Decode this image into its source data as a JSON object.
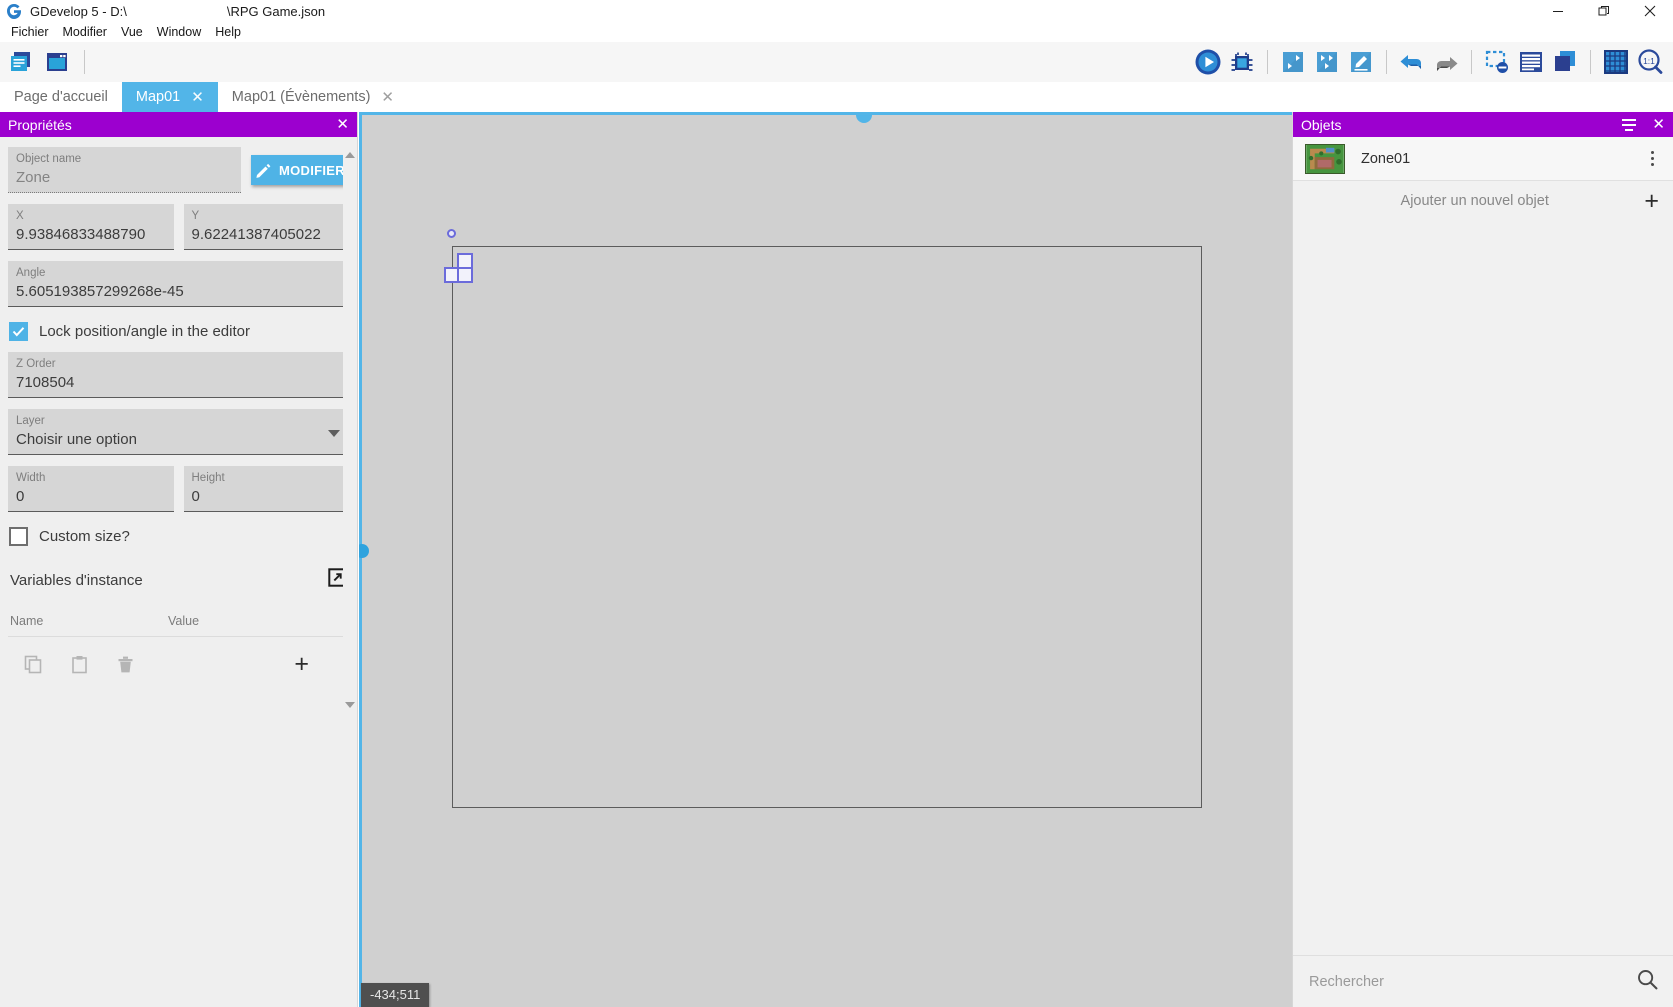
{
  "window": {
    "app_title": "GDevelop 5 - D:\\",
    "file_path": "\\RPG Game.json",
    "controls": {
      "minimize": "—",
      "restore": "❐",
      "close": "✕"
    }
  },
  "menubar": {
    "items": [
      {
        "label": "Fichier",
        "name": "menu-fichier"
      },
      {
        "label": "Modifier",
        "name": "menu-modifier"
      },
      {
        "label": "Vue",
        "name": "menu-vue"
      },
      {
        "label": "Window",
        "name": "menu-window"
      },
      {
        "label": "Help",
        "name": "menu-help"
      }
    ]
  },
  "toolbar": {
    "left_icons": [
      {
        "name": "project-manager-icon",
        "title": "Gestionnaire de projet"
      },
      {
        "name": "open-window-icon",
        "title": "Fenetre"
      }
    ],
    "right_icons": [
      {
        "name": "play-preview-icon",
        "title": "Aperçu"
      },
      {
        "name": "debug-icon",
        "title": "Débogage"
      },
      {
        "name": "add-scene-icon",
        "title": "Ajouter une scène"
      },
      {
        "name": "external-layout-icon",
        "title": "Disposition externe"
      },
      {
        "name": "edit-scene-icon",
        "title": "Éditer"
      },
      {
        "name": "undo-icon",
        "title": "Annuler"
      },
      {
        "name": "redo-icon",
        "title": "Rétablir"
      },
      {
        "name": "no-selection-icon",
        "title": "Désélectionner"
      },
      {
        "name": "open-list-icon",
        "title": "Liste"
      },
      {
        "name": "layers-icon",
        "title": "Calques"
      },
      {
        "name": "grid-icon",
        "title": "Grille"
      },
      {
        "name": "zoom-reset-icon",
        "title": "1:1"
      }
    ]
  },
  "tabs": [
    {
      "label": "Page d'accueil",
      "active": false,
      "closable": false
    },
    {
      "label": "Map01",
      "active": true,
      "closable": true,
      "close": "✕"
    },
    {
      "label": "Map01 (Évènements)",
      "active": false,
      "closable": true,
      "close": "✕"
    }
  ],
  "properties_panel": {
    "title": "Propriétés",
    "close": "✕",
    "object_name": {
      "label": "Object name",
      "value": "Zone"
    },
    "modify_button": {
      "label": "MODIFIER"
    },
    "x": {
      "label": "X",
      "value": "9.93846833488790"
    },
    "y": {
      "label": "Y",
      "value": "9.62241387405022"
    },
    "angle": {
      "label": "Angle",
      "value": "5.605193857299268e-45"
    },
    "lock_checkbox": {
      "label": "Lock position/angle in the editor",
      "checked": true
    },
    "z_order": {
      "label": "Z Order",
      "value": "7108504"
    },
    "layer": {
      "label": "Layer",
      "value": "Choisir une option"
    },
    "width": {
      "label": "Width",
      "value": "0"
    },
    "height": {
      "label": "Height",
      "value": "0"
    },
    "custom_size": {
      "label": "Custom size?",
      "checked": false
    },
    "instance_variables": {
      "title": "Variables d'instance"
    },
    "variables_columns": {
      "name": "Name",
      "value": "Value"
    },
    "variables_tools": [
      {
        "name": "copy-icon"
      },
      {
        "name": "paste-icon"
      },
      {
        "name": "delete-icon"
      }
    ],
    "add_variable": "+"
  },
  "canvas": {
    "coordinates_tooltip": "-434;511"
  },
  "objects_panel": {
    "title": "Objets",
    "close": "✕",
    "items": [
      {
        "name": "Zone01"
      }
    ],
    "add_object": {
      "label": "Ajouter un nouvel objet",
      "plus": "+"
    },
    "search": {
      "placeholder": "Rechercher",
      "value": "Rechercher"
    }
  },
  "colors": {
    "panel_header_purple": "#9c00cf",
    "accent_blue": "#52b5e8",
    "canvas_bg": "#d0d0d0",
    "panel_bg": "#efefef",
    "selection_handle": "#6b6bdb"
  }
}
